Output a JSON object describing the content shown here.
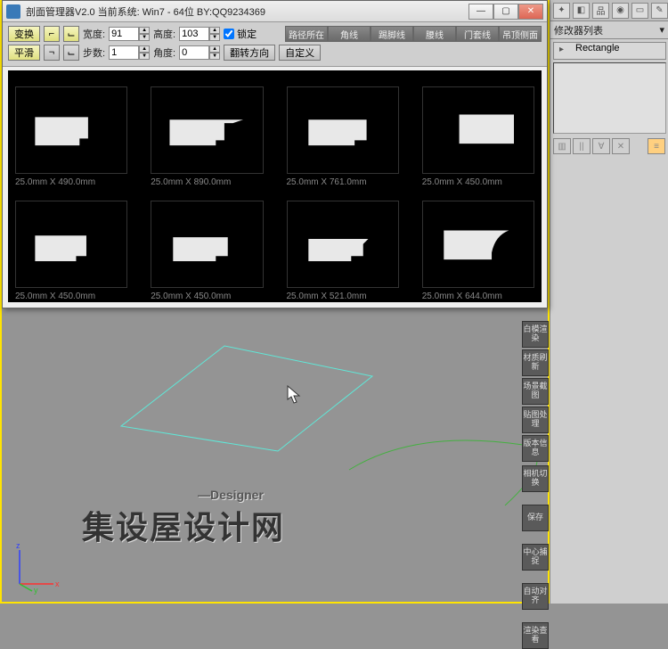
{
  "dialog": {
    "title": "剖面管理器V2.0 当前系统: Win7 - 64位 BY:QQ9234369",
    "btn_replace": "变换",
    "btn_smooth": "平滑",
    "lbl_width": "宽度:",
    "val_width": "91",
    "lbl_height": "高度:",
    "val_height": "103",
    "lbl_steps": "步数:",
    "val_steps": "1",
    "lbl_angle": "角度:",
    "val_angle": "0",
    "chk_lock": "锁定",
    "btn_flip": "翻转方向",
    "btn_custom": "自定义",
    "cats": [
      "路径所在",
      "角线",
      "踢脚线",
      "腰线",
      "门套线",
      "吊顶侧面"
    ]
  },
  "thumbs": [
    "25.0mm X 490.0mm",
    "25.0mm X 890.0mm",
    "25.0mm X 761.0mm",
    "25.0mm X 450.0mm",
    "25.0mm X 450.0mm",
    "25.0mm X 450.0mm",
    "25.0mm X 521.0mm",
    "25.0mm X 644.0mm"
  ],
  "modifier": {
    "header": "修改器列表",
    "item": "Rectangle"
  },
  "sidebtns1": [
    "白模渲染",
    "材质刷新",
    "场景截图",
    "贴图处理",
    "版本信息"
  ],
  "sidebtns2": [
    "相机切换",
    "保存",
    "中心捕捉",
    "自动对齐",
    "渲染查看"
  ],
  "watermark": {
    "brand": "集设屋设计网",
    "sub": "—Designer"
  },
  "axis": {
    "x": "x",
    "y": "y",
    "z": "z"
  }
}
